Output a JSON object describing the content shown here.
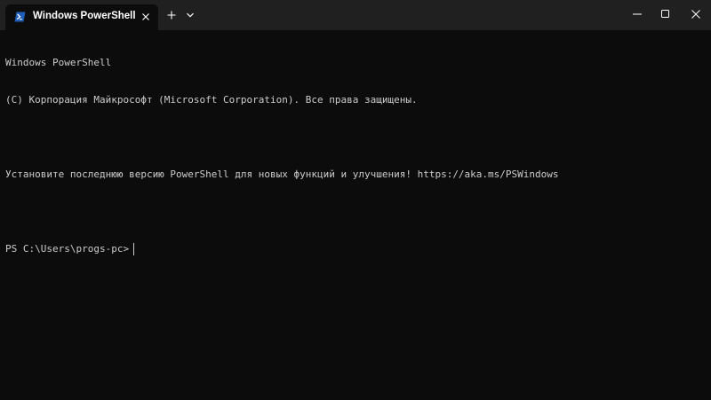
{
  "tab": {
    "title": "Windows PowerShell",
    "icon": "powershell-icon"
  },
  "window_controls": [
    "minimize-icon",
    "maximize-icon",
    "close-icon"
  ],
  "terminal": {
    "lines": [
      "Windows PowerShell",
      "(C) Корпорация Майкрософт (Microsoft Corporation). Все права защищены.",
      "",
      "Установите последнюю версию PowerShell для новых функций и улучшения! https://aka.ms/PSWindows",
      "",
      "PS C:\\Users\\progs-pc>"
    ]
  },
  "colors": {
    "titlebar": "#202020",
    "terminal_bg": "#0c0c0c",
    "terminal_text": "#cccccc"
  }
}
